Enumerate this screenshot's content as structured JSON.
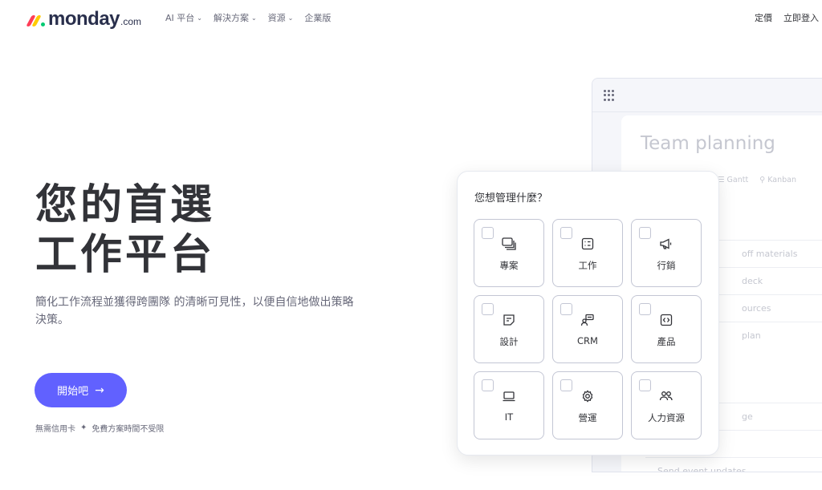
{
  "nav": {
    "logo_word": "monday",
    "logo_suffix": ".com",
    "logo_colors": [
      "#ff3d57",
      "#ffcb00",
      "#00ca72"
    ],
    "menu": [
      {
        "label": "AI 平台",
        "has_dropdown": true
      },
      {
        "label": "解決方案",
        "has_dropdown": true
      },
      {
        "label": "資源",
        "has_dropdown": true
      },
      {
        "label": "企業版",
        "has_dropdown": false
      }
    ],
    "right": {
      "pricing": "定價",
      "login": "立即登入"
    }
  },
  "hero": {
    "title_line1": "您的首選",
    "title_line2": "工作平台",
    "subtitle": "簡化工作流程並獲得跨團隊 的清晰可見性，以便自信地做出策略決策。",
    "cta_label": "開始吧",
    "footnote_left": "無需信用卡",
    "footnote_sep": "✦",
    "footnote_right": "免費方案時間不受限"
  },
  "app_preview": {
    "title": "Team planning",
    "views": [
      "Gantt",
      "Kanban"
    ],
    "rows": [
      "off materials",
      "deck",
      "ources",
      "plan"
    ],
    "rows2": [
      "ge",
      "",
      "Send event updates"
    ]
  },
  "panel": {
    "title": "您想管理什麼？",
    "tiles": [
      {
        "label": "專案",
        "icon": "project-icon"
      },
      {
        "label": "工作",
        "icon": "task-icon"
      },
      {
        "label": "行銷",
        "icon": "megaphone-icon"
      },
      {
        "label": "設計",
        "icon": "design-icon"
      },
      {
        "label": "CRM",
        "icon": "crm-icon"
      },
      {
        "label": "產品",
        "icon": "product-icon"
      },
      {
        "label": "IT",
        "icon": "laptop-icon"
      },
      {
        "label": "營運",
        "icon": "gear-icon"
      },
      {
        "label": "人力資源",
        "icon": "people-icon"
      }
    ]
  },
  "colors": {
    "accent": "#6161ff",
    "text": "#323338",
    "muted": "#676879"
  }
}
